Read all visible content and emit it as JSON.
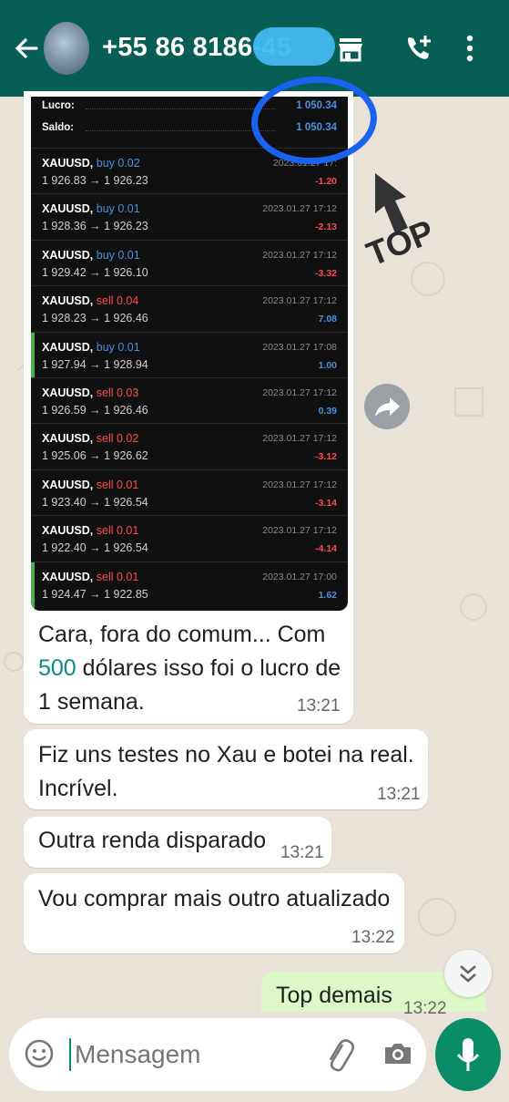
{
  "header": {
    "contact_title": "+55 86 8186-45"
  },
  "report": {
    "summary": [
      {
        "label": "Lucro:",
        "value": "1 050.34"
      },
      {
        "label": "Saldo:",
        "value": "1 050.34"
      }
    ],
    "trades": [
      {
        "symbol": "XAUUSD,",
        "side": "buy 0.02",
        "prices": "1 926.83 → 1 926.23",
        "date": "2023.01.27 17:",
        "profit": "-1.20",
        "color": "#ff4b4b"
      },
      {
        "symbol": "XAUUSD,",
        "side": "buy 0.01",
        "prices": "1 928.36 → 1 926.23",
        "date": "2023.01.27 17:12",
        "profit": "-2.13",
        "color": "#ff4b4b"
      },
      {
        "symbol": "XAUUSD,",
        "side": "buy 0.01",
        "prices": "1 929.42 → 1 926.10",
        "date": "2023.01.27 17:12",
        "profit": "-3.32",
        "color": "#ff4b4b"
      },
      {
        "symbol": "XAUUSD,",
        "side": "sell 0.04",
        "prices": "1 928.23 → 1 926.46",
        "date": "2023.01.27 17:12",
        "profit": "7.08",
        "color": "#4a90e2"
      },
      {
        "symbol": "XAUUSD,",
        "side": "buy 0.01",
        "prices": "1 927.94 → 1 928.94",
        "date": "2023.01.27 17:08",
        "profit": "1.00",
        "color": "#4a90e2"
      },
      {
        "symbol": "XAUUSD,",
        "side": "sell 0.03",
        "prices": "1 926.59 → 1 926.46",
        "date": "2023.01.27 17:12",
        "profit": "0.39",
        "color": "#4a90e2"
      },
      {
        "symbol": "XAUUSD,",
        "side": "sell 0.02",
        "prices": "1 925.06 → 1 926.62",
        "date": "2023.01.27 17:12",
        "profit": "-3.12",
        "color": "#ff4b4b"
      },
      {
        "symbol": "XAUUSD,",
        "side": "sell 0.01",
        "prices": "1 923.40 → 1 926.54",
        "date": "2023.01.27 17:12",
        "profit": "-3.14",
        "color": "#ff4b4b"
      },
      {
        "symbol": "XAUUSD,",
        "side": "sell 0.01",
        "prices": "1 922.40 → 1 926.54",
        "date": "2023.01.27 17:12",
        "profit": "-4.14",
        "color": "#ff4b4b"
      },
      {
        "symbol": "XAUUSD,",
        "side": "sell 0.01",
        "prices": "1 924.47 → 1 922.85",
        "date": "2023.01.27 17:00",
        "profit": "1.62",
        "color": "#4a90e2"
      }
    ]
  },
  "annotation": {
    "top_label": "TOP"
  },
  "messages": [
    {
      "line1": "Cara, fora do comum... Com",
      "line2_num": "500",
      "line2_rest": " dólares isso foi o lucro de",
      "line3": "1 semana.",
      "time": "13:21"
    },
    {
      "line1": "Fiz uns testes no Xau e botei na real.",
      "line2": "Incrível.",
      "time": "13:21"
    },
    {
      "line1": "Outra renda disparado",
      "time": "13:21"
    },
    {
      "line1": "Vou comprar mais outro atualizado",
      "time": "13:22"
    }
  ],
  "outgoing": {
    "text": "Top demais",
    "time": "13:22"
  },
  "input": {
    "placeholder": "Mensagem"
  },
  "colors": {
    "header": "#075e54",
    "link_number": "#0a8a87",
    "send": "#0a8c66"
  }
}
